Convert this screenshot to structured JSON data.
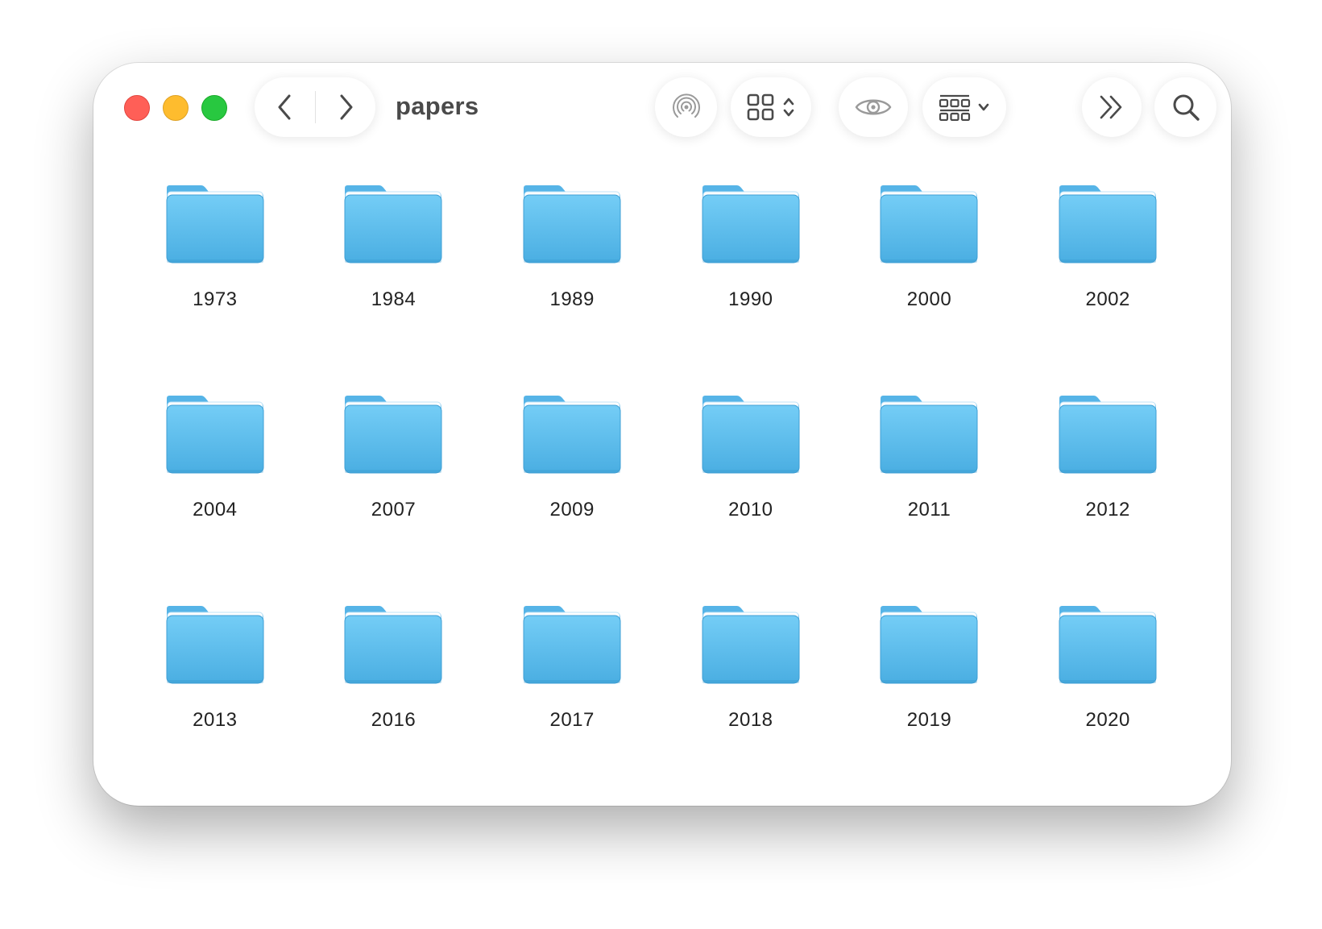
{
  "window": {
    "title": "papers",
    "traffic_lights": [
      {
        "name": "close-button",
        "color": "#ff5f57"
      },
      {
        "name": "minimize-button",
        "color": "#febc2e"
      },
      {
        "name": "zoom-button",
        "color": "#28c840"
      }
    ]
  },
  "toolbar": {
    "back_icon": "chevron-left-icon",
    "forward_icon": "chevron-right-icon",
    "airdrop_icon": "airdrop-icon",
    "view_icon": "grid-view-icon",
    "quicklook_icon": "eye-icon",
    "group_icon": "group-by-icon",
    "more_icon": "double-chevron-right-icon",
    "search_icon": "search-icon"
  },
  "folder_color": "#5ab5eb",
  "folders": [
    "1973",
    "1984",
    "1989",
    "1990",
    "2000",
    "2002",
    "2004",
    "2007",
    "2009",
    "2010",
    "2011",
    "2012",
    "2013",
    "2016",
    "2017",
    "2018",
    "2019",
    "2020"
  ]
}
